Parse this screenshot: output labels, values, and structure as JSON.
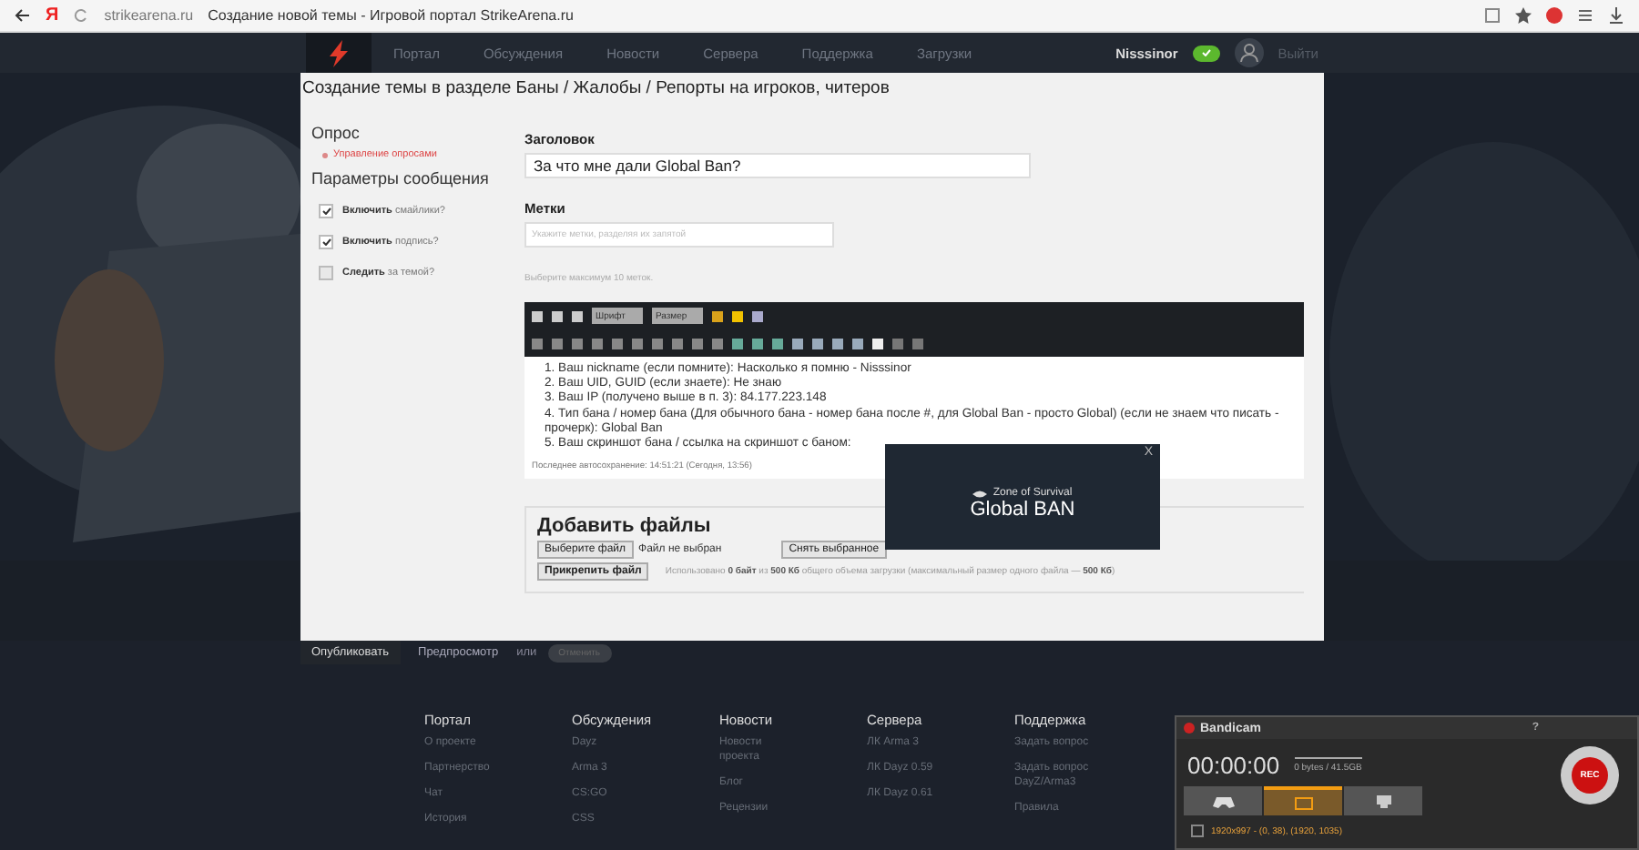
{
  "browser": {
    "url": "strikearena.ru",
    "tab_title": "Создание новой темы - Игровой портал StrikeArena.ru",
    "logo": "Я"
  },
  "header": {
    "nav": [
      {
        "label": "Портал"
      },
      {
        "label": "Обсуждения"
      },
      {
        "label": "Новости"
      },
      {
        "label": "Сервера"
      },
      {
        "label": "Поддержка"
      },
      {
        "label": "Загрузки"
      }
    ],
    "username": "Nisssinor",
    "online": true,
    "logout": "Выйти"
  },
  "page_title": "Создание темы в разделе Баны / Жалобы / Репорты на игроков, читеров",
  "sidebar": {
    "poll_heading": "Опрос",
    "poll_link": "Управление опросами",
    "options_heading": "Параметры сообщения",
    "options": [
      {
        "label": "**Включить** смайлики?",
        "checked": true
      },
      {
        "label": "**Включить** подпись?",
        "checked": true
      },
      {
        "label": "**Следить** за темой?",
        "checked": false
      }
    ]
  },
  "form": {
    "title_label": "Заголовок",
    "title_value": "За что мне дали Global Ban?",
    "tags_label": "Метки",
    "tags_placeholder": "Укажите метки, разделяя их запятой",
    "tags_hint": "Выберите максимум 10 меток."
  },
  "editor": {
    "font_select": "Шрифт",
    "size_select": "Размер",
    "lines": [
      "1. Ваш nickname (если помните): Насколько я помню - Nisssinor",
      "2. Ваш UID, GUID (если знаете): Не знаю",
      "3. Ваш IP (получено выше в п. 3): 84.177.223.148",
      "4. Тип бана / номер бана (Для обычного бана - номер бана после #, для Global Ban - просто Global) (если не знаем что писать - прочерк): Global Ban",
      "5. Ваш скриншот бана / ссылка на скриншот с баном:"
    ],
    "autosave": "Последнее автосохранение: 14:51:21 (Сегодня, 13:56)"
  },
  "upload": {
    "title": "Добавить файлы",
    "choose": "Выберите файл",
    "no_file": "Файл не выбран",
    "clear": "Снять выбранное",
    "attach": "Прикрепить файл",
    "usage": "Использовано **0 байт** из **500 Кб** общего объема загрузки (максимальный размер одного файла — **500 Кб**)"
  },
  "actions": {
    "publish": "Опубликовать",
    "preview": "Предпросмотр",
    "or": "или",
    "cancel": {
      "label": "Отменить",
      "disabled": true
    }
  },
  "footer": {
    "columns": [
      {
        "title": "Портал",
        "items": [
          "О проекте",
          "Партнерство",
          "Чат",
          "История"
        ]
      },
      {
        "title": "Обсуждения",
        "items": [
          "Dayz",
          "Arma 3",
          "CS:GO",
          "CSS"
        ]
      },
      {
        "title": "Новости",
        "items": [
          "Новости проекта",
          "Блог",
          "Рецензии"
        ]
      },
      {
        "title": "Сервера",
        "items": [
          "ЛК Arma 3",
          "ЛК Dayz 0.59",
          "ЛК Dayz 0.61"
        ]
      },
      {
        "title": "Поддержка",
        "items": [
          "Задать вопрос",
          "Задать вопрос DayZ/Arma3",
          "Правила"
        ]
      }
    ]
  },
  "popup": {
    "brand": "Zone of Survival",
    "title": "Global BAN",
    "close": "X"
  },
  "recorder": {
    "title": "Bandicam",
    "help": "?",
    "time": "00:00:00",
    "size": "0 bytes / 41.5GB",
    "rec": "REC",
    "region_checked": false,
    "region": "1920x997 - (0, 38), (1920, 1035)",
    "modes": [
      {
        "kind": "game",
        "selected": false
      },
      {
        "kind": "screen",
        "selected": true
      },
      {
        "kind": "device",
        "selected": false
      }
    ]
  }
}
